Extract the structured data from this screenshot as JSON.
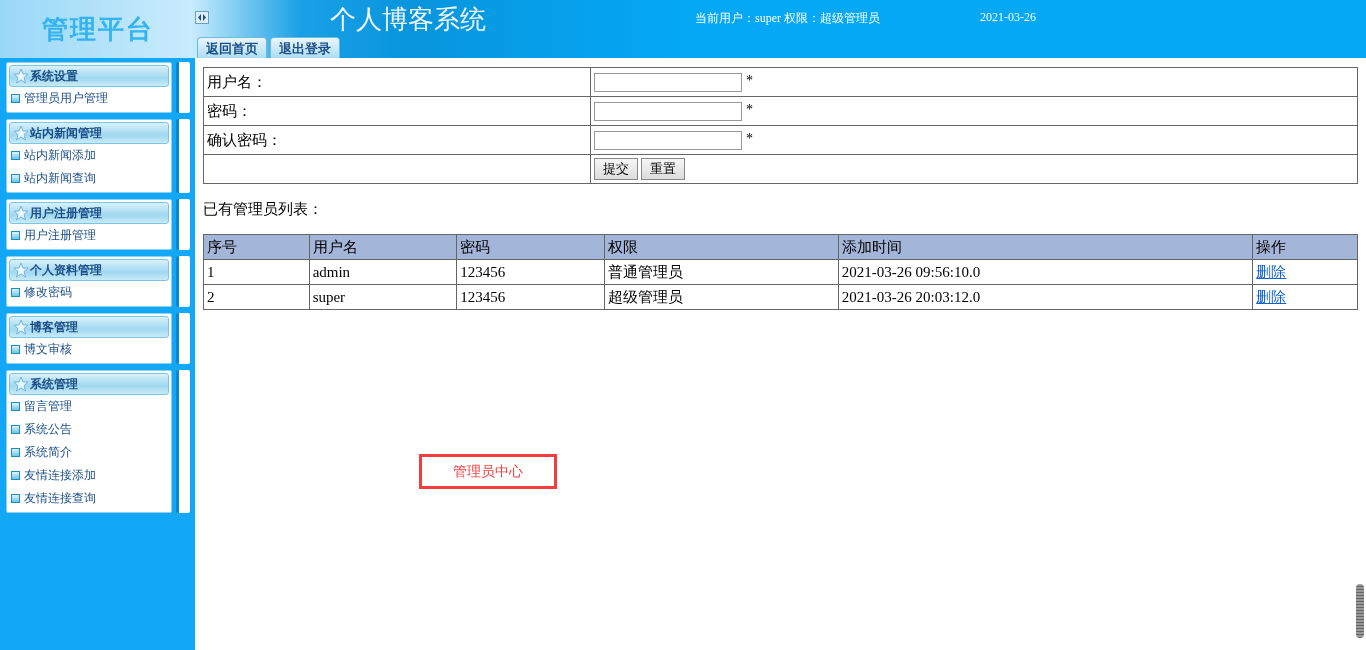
{
  "header": {
    "platform_title": "管理平台",
    "system_title": "个人博客系统",
    "tabs": [
      {
        "label": "返回首页"
      },
      {
        "label": "退出登录"
      }
    ],
    "user_info": "当前用户：super 权限：超级管理员",
    "date": "2021-03-26"
  },
  "sidebar": {
    "groups": [
      {
        "title": "系统设置",
        "items": [
          "管理员用户管理"
        ]
      },
      {
        "title": "站内新闻管理",
        "items": [
          "站内新闻添加",
          "站内新闻查询"
        ]
      },
      {
        "title": "用户注册管理",
        "items": [
          "用户注册管理"
        ]
      },
      {
        "title": "个人资料管理",
        "items": [
          "修改密码"
        ]
      },
      {
        "title": "博客管理",
        "items": [
          "博文审核"
        ]
      },
      {
        "title": "系统管理",
        "items": [
          "留言管理",
          "系统公告",
          "系统简介",
          "友情连接添加",
          "友情连接查询"
        ]
      }
    ]
  },
  "form": {
    "fields": [
      {
        "label": "用户名：",
        "required": "*"
      },
      {
        "label": "密码：",
        "required": "*"
      },
      {
        "label": "确认密码：",
        "required": "*"
      }
    ],
    "buttons": [
      "提交",
      "重置"
    ]
  },
  "list_title": "已有管理员列表：",
  "table": {
    "columns": [
      "序号",
      "用户名",
      "密码",
      "权限",
      "添加时间",
      "操作"
    ],
    "rows": [
      {
        "cells": [
          "1",
          "admin",
          "123456",
          "普通管理员",
          "2021-03-26 09:56:10.0"
        ],
        "action": "删除"
      },
      {
        "cells": [
          "2",
          "super",
          "123456",
          "超级管理员",
          "2021-03-26 20:03:12.0"
        ],
        "action": "删除"
      }
    ]
  },
  "caption": "管理员中心"
}
